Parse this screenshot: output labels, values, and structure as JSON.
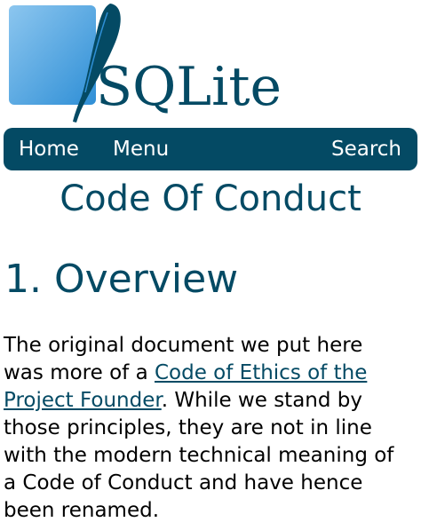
{
  "logo": {
    "text": "SQLite",
    "icon": "feather-icon",
    "colors": {
      "box": "#2f8fd6",
      "box_light": "#8cc6ef",
      "feather": "#044a64",
      "text": "#044a64"
    }
  },
  "nav": {
    "home_label": "Home",
    "menu_label": "Menu",
    "search_label": "Search",
    "background": "#044a64"
  },
  "page": {
    "title": "Code Of Conduct"
  },
  "section": {
    "number": "1.",
    "title": "Overview"
  },
  "intro": {
    "line1": "The original document we put here",
    "line2_before": "was more of a ",
    "link_part1": "Code of Ethics of the",
    "link_part2": "Project Founder",
    "line3_after": ". While we stand by",
    "line4": "those principles, they are not in line",
    "line5": "with the modern technical meaning of",
    "line6": "a Code of Conduct and have hence",
    "line7": "been renamed."
  }
}
